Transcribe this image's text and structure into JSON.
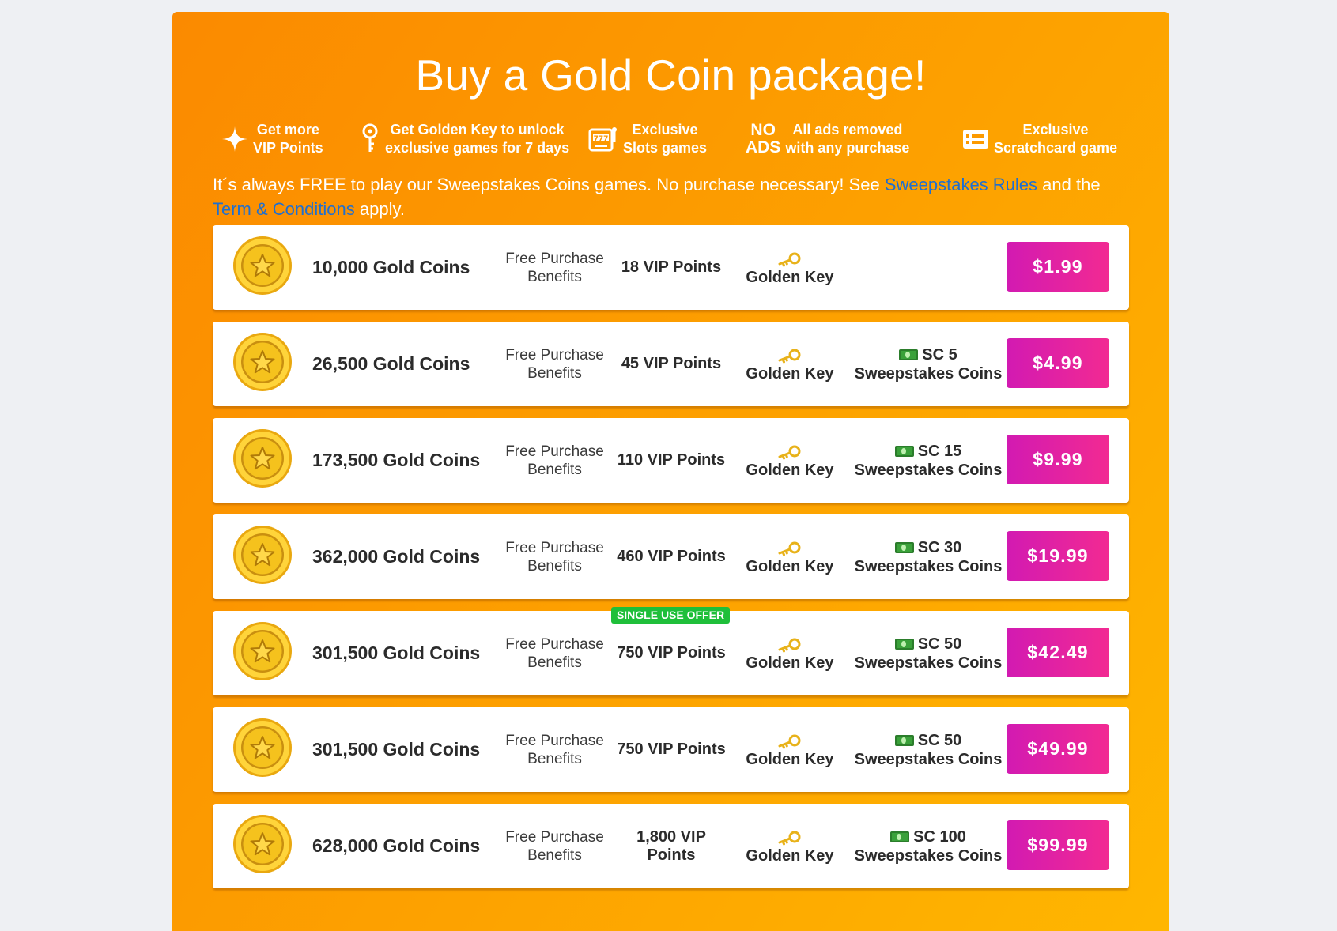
{
  "title": "Buy a Gold Coin package!",
  "features": [
    {
      "icon": "sparkle-icon",
      "line1": "Get more",
      "line2": "VIP Points"
    },
    {
      "icon": "key-icon",
      "line1": "Get Golden Key to unlock",
      "line2": "exclusive games for 7 days"
    },
    {
      "icon": "slot-machine-icon",
      "line1": "Exclusive",
      "line2": "Slots games"
    },
    {
      "icon": "no-ads-icon",
      "icon_line1": "NO",
      "icon_line2": "ADS",
      "line1": "All ads removed",
      "line2": "with any purchase"
    },
    {
      "icon": "scratchcard-icon",
      "line1": "Exclusive",
      "line2": "Scratchcard game"
    }
  ],
  "notice": {
    "text1": "It´s always FREE to play our Sweepstakes Coins games. No purchase necessary! See ",
    "link1": "Sweepstakes Rules",
    "text2": " and the ",
    "link2": "Term & Conditions",
    "text3": " apply."
  },
  "benefits_line1": "Free Purchase",
  "benefits_line2": "Benefits",
  "key_label": "Golden Key",
  "sc_suffix": "Sweepstakes Coins",
  "packages": [
    {
      "coins": "10,000 Gold Coins",
      "vip": "18 VIP Points",
      "sc": "",
      "price": "$1.99",
      "badge": ""
    },
    {
      "coins": "26,500 Gold Coins",
      "vip": "45 VIP Points",
      "sc": "SC 5",
      "price": "$4.99",
      "badge": ""
    },
    {
      "coins": "173,500 Gold Coins",
      "vip": "110 VIP Points",
      "sc": "SC 15",
      "price": "$9.99",
      "badge": ""
    },
    {
      "coins": "362,000 Gold Coins",
      "vip": "460 VIP Points",
      "sc": "SC 30",
      "price": "$19.99",
      "badge": ""
    },
    {
      "coins": "301,500 Gold Coins",
      "vip": "750 VIP Points",
      "sc": "SC 50",
      "price": "$42.49",
      "badge": "SINGLE USE OFFER"
    },
    {
      "coins": "301,500 Gold Coins",
      "vip": "750 VIP Points",
      "sc": "SC 50",
      "price": "$49.99",
      "badge": ""
    },
    {
      "coins": "628,000 Gold Coins",
      "vip": "1,800 VIP Points",
      "sc": "SC 100",
      "price": "$99.99",
      "badge": ""
    }
  ],
  "colors": {
    "panel_start": "#fb8a00",
    "panel_end": "#ffb700",
    "price_start": "#d21ab2",
    "price_end": "#f22a92",
    "badge": "#1fbf3a",
    "link": "#1f6fd0"
  }
}
